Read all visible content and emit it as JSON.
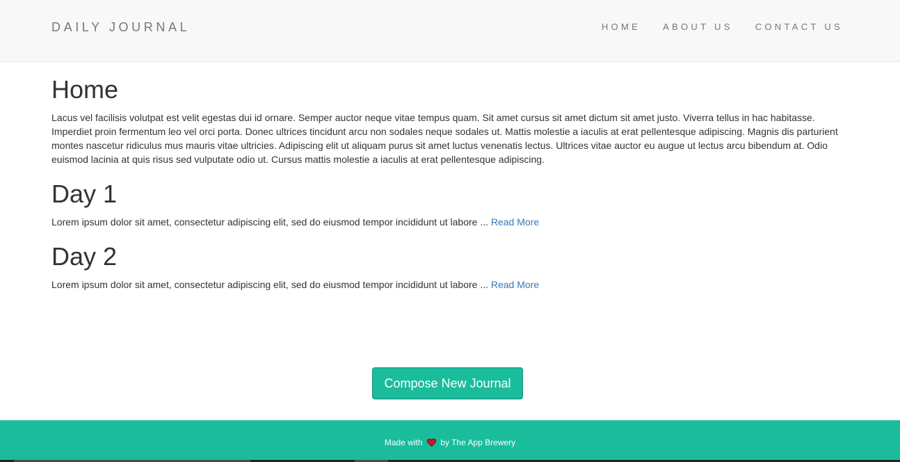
{
  "navbar": {
    "brand": "DAILY JOURNAL",
    "links": [
      {
        "label": "HOME"
      },
      {
        "label": "ABOUT US"
      },
      {
        "label": "CONTACT US"
      }
    ]
  },
  "home": {
    "title": "Home",
    "body": "Lacus vel facilisis volutpat est velit egestas dui id ornare. Semper auctor neque vitae tempus quam. Sit amet cursus sit amet dictum sit amet justo. Viverra tellus in hac habitasse. Imperdiet proin fermentum leo vel orci porta. Donec ultrices tincidunt arcu non sodales neque sodales ut. Mattis molestie a iaculis at erat pellentesque adipiscing. Magnis dis parturient montes nascetur ridiculus mus mauris vitae ultricies. Adipiscing elit ut aliquam purus sit amet luctus venenatis lectus. Ultrices vitae auctor eu augue ut lectus arcu bibendum at. Odio euismod lacinia at quis risus sed vulputate odio ut. Cursus mattis molestie a iaculis at erat pellentesque adipiscing."
  },
  "posts": [
    {
      "title": "Day 1",
      "excerpt": "Lorem ipsum dolor sit amet, consectetur adipiscing elit, sed do eiusmod tempor incididunt ut labore ... ",
      "read_more": "Read More"
    },
    {
      "title": "Day 2",
      "excerpt": "Lorem ipsum dolor sit amet, consectetur adipiscing elit, sed do eiusmod tempor incididunt ut labore ... ",
      "read_more": "Read More"
    }
  ],
  "compose_button": "Compose New Journal",
  "footer": {
    "prefix": "Made with",
    "icon": "heart-icon",
    "suffix": "by The App Brewery"
  },
  "colors": {
    "accent": "#1abc9c",
    "link": "#337ab7",
    "navbar_bg": "#f8f8f8",
    "heart": "#e0102a"
  }
}
